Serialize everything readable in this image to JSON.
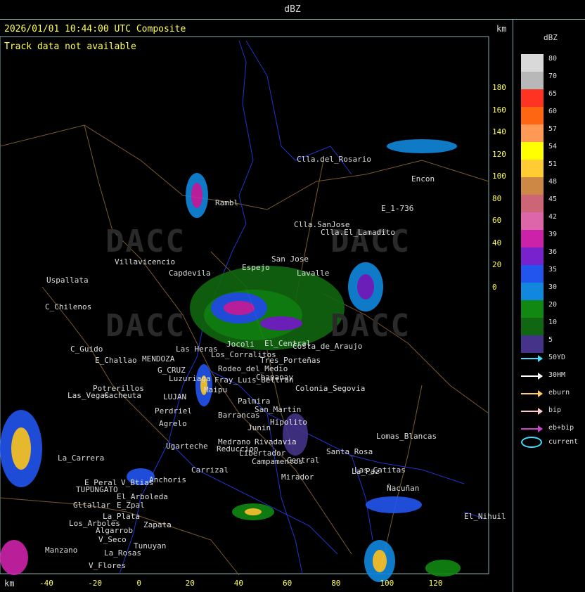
{
  "window": {
    "title": "dBZ"
  },
  "map": {
    "header": "2026/01/01 10:44:00 UTC Composite",
    "status": "Track data not available",
    "km_top": "km",
    "km_bottom": "km",
    "y_ticks": [
      "180",
      "160",
      "140",
      "120",
      "100",
      "80",
      "60",
      "40",
      "20",
      "0"
    ],
    "x_ticks": [
      "-40",
      "-20",
      "0",
      "20",
      "40",
      "60",
      "80",
      "100",
      "120"
    ],
    "places": [
      "Clla.del_Rosario",
      "Encon",
      "E_1-736",
      "Rambl",
      "Clla.SanJose",
      "Clla.El_Lamadito",
      "Villavicencio",
      "San Jose",
      "Capdevila",
      "Uspallata",
      "C_Chilenos",
      "Lavalle",
      "C_Guido",
      "E_Challao",
      "MENDOZA",
      "G_CRUZ",
      "Luzuriaga",
      "Las Heras",
      "Potrerillos",
      "Las_Vegas",
      "Cacheuta",
      "LUJAN",
      "Perdriel",
      "Agrelo",
      "Ugarteche",
      "La_Carrera",
      "E_Peral",
      "TUPUNGATO",
      "V_Btias",
      "Anchoris",
      "El_Arboleda",
      "Gltallar",
      "E_Zpal",
      "La_Plata",
      "Los_Arboles",
      "Algarrob",
      "V_Seco",
      "Zapata",
      "Tunuyan",
      "Manzano",
      "La_Rosas",
      "V_Flores",
      "Maipu",
      "Barrancas",
      "Carrizal",
      "Medrano",
      "Reduccion",
      "Junin",
      "Rivadavia",
      "Libertador",
      "Campamentos",
      "Mirador",
      "Central",
      "La_Paz",
      "Lomas_Blancas",
      "San_Martin",
      "Palmira",
      "Chapanay",
      "Tres_Porteñas",
      "Santa_Rosa",
      "Las_Catitas",
      "Ñacuñan",
      "El_Nihuil",
      "Costa_de_Araujo",
      "Jocoli",
      "El_Central",
      "Colonia_Segovia",
      "Fray_Luis_Beltran",
      "Los_Corralitos",
      "Rodeo_del_Medio",
      "Espejo",
      "Hipolito"
    ]
  },
  "legend": {
    "title": "dBZ",
    "bins": [
      {
        "value": "80",
        "color": "#d9d9d9"
      },
      {
        "value": "70",
        "color": "#b8b8b8"
      },
      {
        "value": "65",
        "color": "#ff3322"
      },
      {
        "value": "60",
        "color": "#ff6611"
      },
      {
        "value": "57",
        "color": "#ff9955"
      },
      {
        "value": "54",
        "color": "#ffff00"
      },
      {
        "value": "51",
        "color": "#ffcc33"
      },
      {
        "value": "48",
        "color": "#cc8844"
      },
      {
        "value": "45",
        "color": "#cc6677"
      },
      {
        "value": "42",
        "color": "#dd66aa"
      },
      {
        "value": "39",
        "color": "#cc22aa"
      },
      {
        "value": "36",
        "color": "#7722cc"
      },
      {
        "value": "35",
        "color": "#2255ee"
      },
      {
        "value": "30",
        "color": "#1188dd"
      },
      {
        "value": "20",
        "color": "#118811"
      },
      {
        "value": "10",
        "color": "#116611"
      },
      {
        "value": "5",
        "color": "#443388"
      }
    ],
    "tracks": [
      {
        "label": "50YD",
        "color": "#44ddff"
      },
      {
        "label": "30HM",
        "color": "#ffffff"
      },
      {
        "label": "eburn",
        "color": "#ffcc66"
      },
      {
        "label": "bip",
        "color": "#ffcccc"
      },
      {
        "label": "eb+bip",
        "color": "#cc44cc"
      }
    ],
    "current_label": "current"
  }
}
